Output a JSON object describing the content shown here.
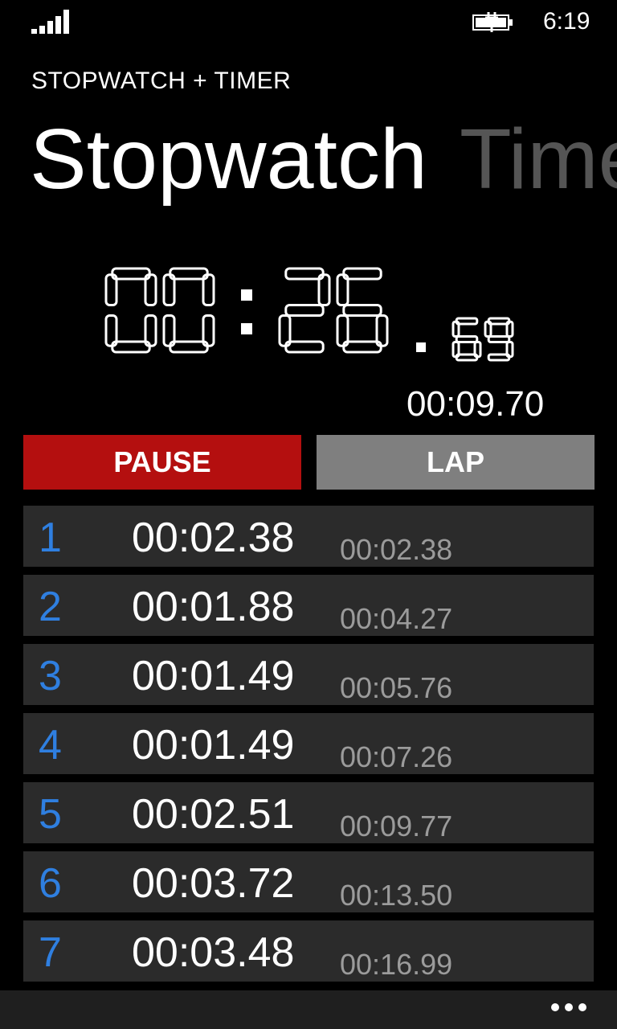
{
  "status_bar": {
    "time": "6:19",
    "signal_icon": "signal-strength-icon",
    "battery_icon": "battery-charging-icon"
  },
  "app": {
    "title": "STOPWATCH + TIMER",
    "pivot": {
      "active": "Stopwatch",
      "next": "Timer"
    }
  },
  "stopwatch": {
    "minutes": "00",
    "seconds": "26",
    "hundredths": "69",
    "current_lap": "00:09.70"
  },
  "buttons": {
    "pause": "PAUSE",
    "lap": "LAP"
  },
  "laps": [
    {
      "num": "1",
      "lap": "00:02.38",
      "total": "00:02.38"
    },
    {
      "num": "2",
      "lap": "00:01.88",
      "total": "00:04.27"
    },
    {
      "num": "3",
      "lap": "00:01.49",
      "total": "00:05.76"
    },
    {
      "num": "4",
      "lap": "00:01.49",
      "total": "00:07.26"
    },
    {
      "num": "5",
      "lap": "00:02.51",
      "total": "00:09.77"
    },
    {
      "num": "6",
      "lap": "00:03.72",
      "total": "00:13.50"
    },
    {
      "num": "7",
      "lap": "00:03.48",
      "total": "00:16.99"
    }
  ],
  "colors": {
    "background": "#000000",
    "pause_button": "#b40f0f",
    "lap_button": "#7f7f7f",
    "lap_number": "#2f7fe0",
    "row_background": "#2b2b2b"
  },
  "app_bar": {
    "more_icon": "more-options-icon"
  }
}
